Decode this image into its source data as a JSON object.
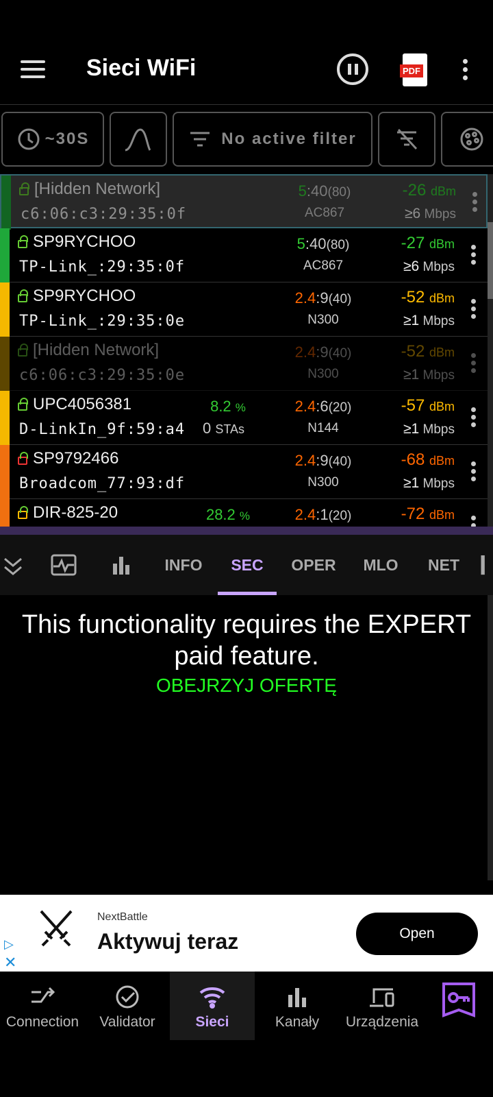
{
  "header": {
    "title": "Sieci WiFi",
    "pdf_label": "PDF"
  },
  "toolbar": {
    "interval_label": "~30S",
    "filter_label": "No active filter"
  },
  "networks": [
    {
      "ssid": "[Hidden Network]",
      "bssid": "c6:06:c3:29:35:0f",
      "band": "5",
      "channel": ":40",
      "width": "(80)",
      "standard": "AC867",
      "signal": "-26",
      "signal_unit": "dBm",
      "rate": "≥6",
      "rate_unit": "Mbps",
      "bar_color": "#1fa83a",
      "band_color": "#3c3",
      "signal_color": "#3c3",
      "state": "selected"
    },
    {
      "ssid": "SP9RYCHOO",
      "bssid": "TP-Link_:29:35:0f",
      "band": "5",
      "channel": ":40",
      "width": "(80)",
      "standard": "AC867",
      "signal": "-27",
      "signal_unit": "dBm",
      "rate": "≥6",
      "rate_unit": "Mbps",
      "bar_color": "#1fa83a",
      "band_color": "#3c3",
      "signal_color": "#3c3",
      "state": "normal"
    },
    {
      "ssid": "SP9RYCHOO",
      "bssid": "TP-Link_:29:35:0e",
      "band": "2.4",
      "channel": ":9",
      "width": "(40)",
      "standard": "N300",
      "signal": "-52",
      "signal_unit": "dBm",
      "rate": "≥1",
      "rate_unit": "Mbps",
      "bar_color": "#f5b800",
      "band_color": "#f60",
      "signal_color": "#fb0",
      "state": "normal"
    },
    {
      "ssid": "[Hidden Network]",
      "bssid": "c6:06:c3:29:35:0e",
      "band": "2.4",
      "channel": ":9",
      "width": "(40)",
      "standard": "N300",
      "signal": "-52",
      "signal_unit": "dBm",
      "rate": "≥1",
      "rate_unit": "Mbps",
      "bar_color": "#f5b800",
      "band_color": "#f60",
      "signal_color": "#fb0",
      "state": "dim"
    },
    {
      "ssid": "UPC4056381",
      "bssid": "D-LinkIn_9f:59:a4",
      "band": "2.4",
      "channel": ":6",
      "width": "(20)",
      "standard": "N144",
      "signal": "-57",
      "signal_unit": "dBm",
      "rate": "≥1",
      "rate_unit": "Mbps",
      "util": "8.2",
      "util_unit": "%",
      "stas": "0",
      "stas_label": "STAs",
      "bar_color": "#f5b800",
      "band_color": "#f60",
      "signal_color": "#fb0",
      "state": "normal"
    },
    {
      "ssid": "SP9792466",
      "bssid": "Broadcom_77:93:df",
      "band": "2.4",
      "channel": ":9",
      "width": "(40)",
      "standard": "N300",
      "signal": "-68",
      "signal_unit": "dBm",
      "rate": "≥1",
      "rate_unit": "Mbps",
      "bar_color": "#f07010",
      "band_color": "#f60",
      "signal_color": "#f60",
      "lock_color": "#e33",
      "state": "normal"
    },
    {
      "ssid": "DIR-825-20",
      "bssid": "",
      "band": "2.4",
      "channel": ":1",
      "width": "(20)",
      "standard": "",
      "signal": "-72",
      "signal_unit": "dBm",
      "rate": "",
      "rate_unit": "",
      "util": "28.2",
      "util_unit": "%",
      "bar_color": "#f07010",
      "band_color": "#f60",
      "signal_color": "#f60",
      "lock_color": "#fb0",
      "state": "normal"
    }
  ],
  "detail_tabs": [
    "INFO",
    "SEC",
    "OPER",
    "MLO",
    "NET"
  ],
  "active_tab": "SEC",
  "message": {
    "line1": "This functionality requires the EXPERT",
    "line2": "paid feature.",
    "offer": "OBEJRZYJ OFERTĘ"
  },
  "ad": {
    "advertiser": "NextBattle",
    "headline": "Aktywuj teraz",
    "button": "Open"
  },
  "bottom_nav": [
    {
      "label": "Connection",
      "icon": "connection-icon"
    },
    {
      "label": "Validator",
      "icon": "check-circle-icon"
    },
    {
      "label": "Sieci",
      "icon": "wifi-icon"
    },
    {
      "label": "Kanały",
      "icon": "bar-chart-icon"
    },
    {
      "label": "Urządzenia",
      "icon": "devices-icon"
    },
    {
      "label": "",
      "icon": "premium-badge-icon"
    }
  ],
  "active_nav": "Sieci"
}
